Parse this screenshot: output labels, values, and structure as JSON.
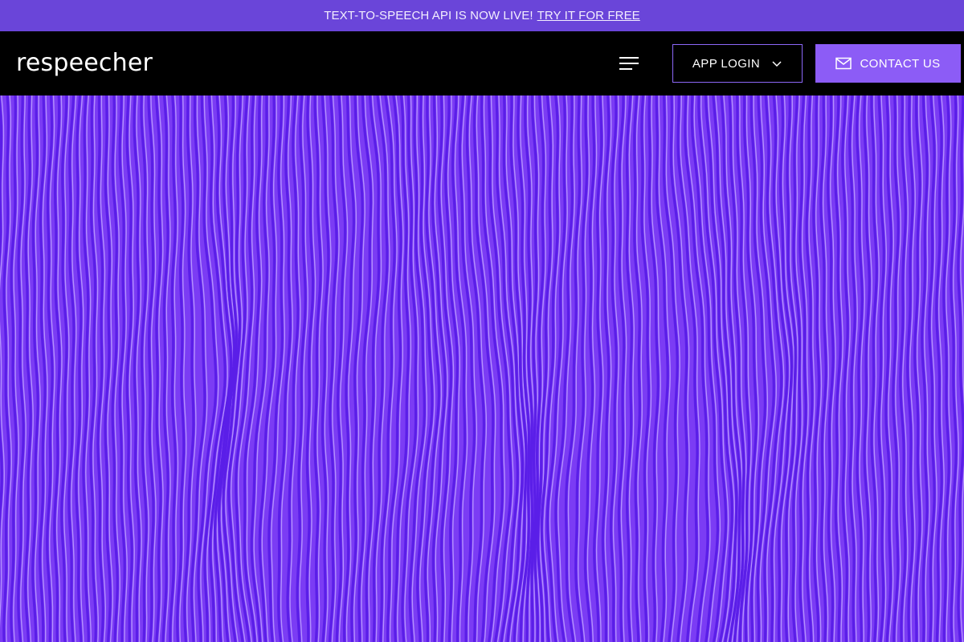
{
  "banner": {
    "text": "TEXT-TO-SPEECH API IS NOW LIVE!",
    "link": "TRY IT FOR FREE"
  },
  "nav": {
    "logo": "respeecher",
    "menu_icon": "hamburger-menu-icon",
    "login_label": "APP LOGIN",
    "login_icon": "chevron-down-icon",
    "contact_label": "CONTACT US",
    "contact_icon": "envelope-icon"
  },
  "colors": {
    "banner_bg": "#6a45d9",
    "nav_bg": "#000000",
    "accent": "#8c5cf6",
    "hero_base": "#7b3cf4"
  }
}
